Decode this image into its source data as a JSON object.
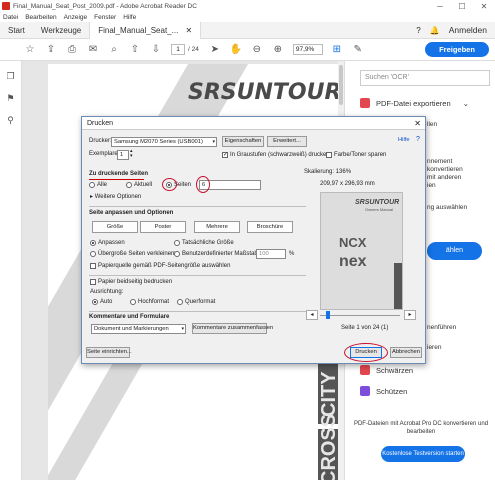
{
  "window": {
    "title": "Final_Manual_Seat_Post_2009.pdf - Adobe Acrobat Reader DC"
  },
  "menu": [
    "Datei",
    "Bearbeiten",
    "Anzeige",
    "Fenster",
    "Hilfe"
  ],
  "tabs": {
    "start": "Start",
    "tools": "Werkzeuge",
    "document": "Final_Manual_Seat_...",
    "login": "Anmelden"
  },
  "toolbar": {
    "page_current": "1",
    "page_total": "/ 24",
    "zoom": "97,9%",
    "share": "Freigeben"
  },
  "document": {
    "logo": "SRSUNTOUR",
    "band_text_1": "CITY",
    "band_text_2": "CROSS"
  },
  "right_panel": {
    "search_placeholder": "Suchen 'OCR'",
    "export_pdf": "PDF-Datei exportieren",
    "partial_1": "llen",
    "partial_2": "nnement",
    "partial_3": "konvertieren",
    "partial_4": "mit anderen",
    "partial_5": "ien",
    "partial_6": "ng auswählen",
    "partial_7": "ählen",
    "partial_8": "nenführen",
    "partial_9": "ieren",
    "redact": "Schwärzen",
    "protect": "Schützen",
    "promo": "PDF-Dateien mit Acrobat Pro DC konvertieren und bearbeiten",
    "trial_button": "Kostenlose Testversion starten"
  },
  "dialog": {
    "title": "Drucken",
    "help": "Hilfe",
    "printer_label": "Drucker:",
    "printer_value": "Samsung M2070 Series (USB001)",
    "properties_btn": "Eigenschaften",
    "advanced_btn": "Erweitert...",
    "copies_label": "Exemplare:",
    "copies_value": "1",
    "grayscale_label": "In Graustufen (schwarzweiß) drucken",
    "toner_label": "Farbe/Toner sparen",
    "pages_section": "Zu druckende Seiten",
    "radio_all": "Alle",
    "radio_current": "Aktuell",
    "radio_pages": "Seiten",
    "pages_value": "6",
    "more_options": "Weitere Optionen",
    "fit_section": "Seite anpassen und Optionen",
    "seg_size": "Größe",
    "seg_poster": "Poster",
    "seg_multiple": "Mehrere",
    "seg_booklet": "Broschüre",
    "fit_label": "Anpassen",
    "actual_size": "Tatsächliche Größe",
    "shrink_large": "Übergroße Seiten verkleinern",
    "custom_scale": "Benutzerdefinierter Maßstab:",
    "custom_scale_value": "100",
    "percent": "%",
    "paper_source": "Papierquelle gemäß PDF-Seitengröße auswählen",
    "both_sides": "Papier beidseitig bedrucken",
    "orientation_label": "Ausrichtung:",
    "orient_auto": "Auto",
    "orient_portrait": "Hochformat",
    "orient_landscape": "Querformat",
    "comments_section": "Kommentare und Formulare",
    "comments_value": "Dokument und Markierungen",
    "comments_summary_btn": "Kommentare zusammenfassen",
    "scaling": "Skalierung: 136%",
    "paper_size": "209,97 x 296,93 mm",
    "page_indicator": "Seite 1 von 24 (1)",
    "page_setup_btn": "Seite einrichten...",
    "print_btn": "Drucken",
    "cancel_btn": "Abbrechen",
    "preview_logo": "SRSUNTOUR",
    "preview_subtitle": "Owners Manual",
    "preview_brand_1": "NCX",
    "preview_brand_2": "nex"
  }
}
